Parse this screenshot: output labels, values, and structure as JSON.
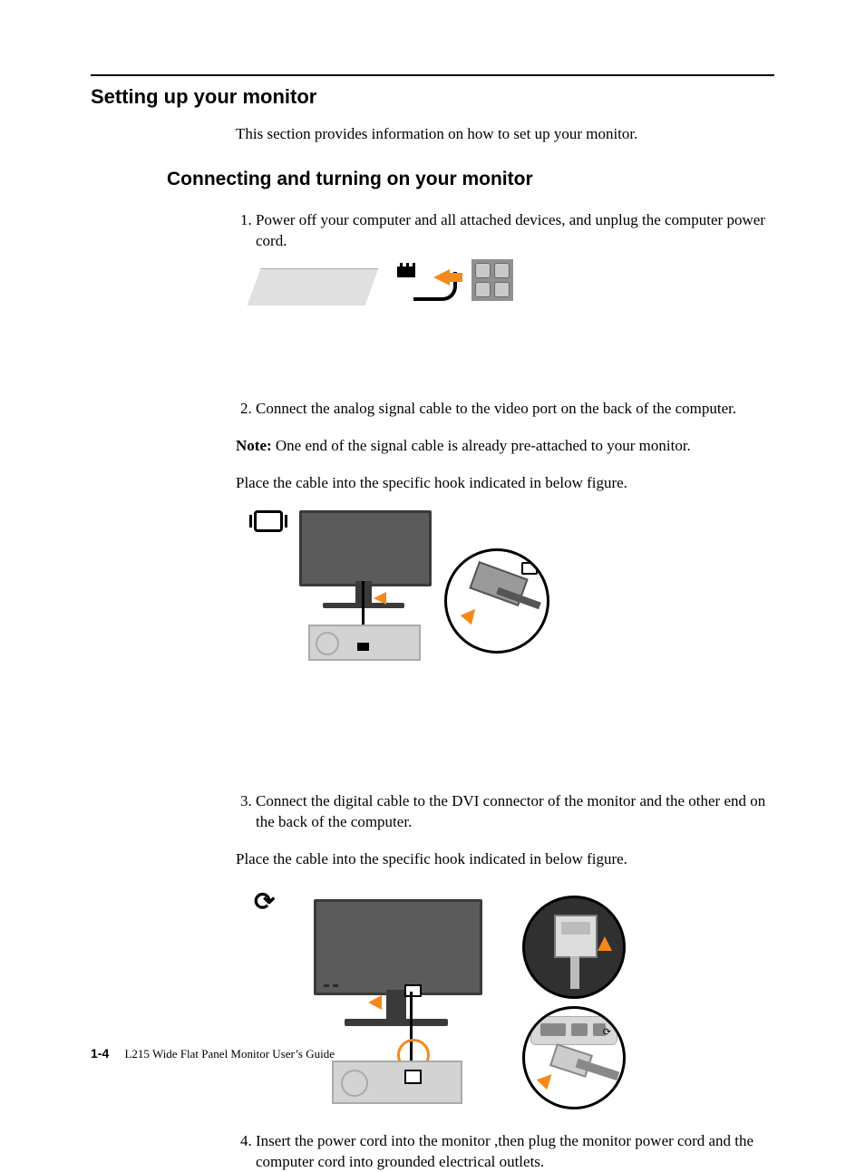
{
  "heading1": "Setting up your monitor",
  "intro": "This section provides information on how to set up your monitor.",
  "heading2": "Connecting and turning on your monitor",
  "steps": {
    "s1": "Power off your computer and all attached devices, and unplug the computer power cord.",
    "s2": "Connect the analog signal cable to the video port on the back of the computer.",
    "note_label": "Note:",
    "note2": "One end of the signal cable is already pre-attached to your monitor.",
    "hook2": "Place the cable into the specific hook indicated in below figure.",
    "s3": "Connect the digital cable to the DVI connector of  the monitor and the other end on the back of the computer.",
    "hook3": "Place the cable into the specific hook indicated in below figure.",
    "s4": "Insert the power cord into the monitor ,then plug the monitor power cord and the computer cord into grounded electrical outlets."
  },
  "footer": {
    "page": "1-4",
    "title": "L215 Wide Flat Panel Monitor User’s Guide"
  }
}
